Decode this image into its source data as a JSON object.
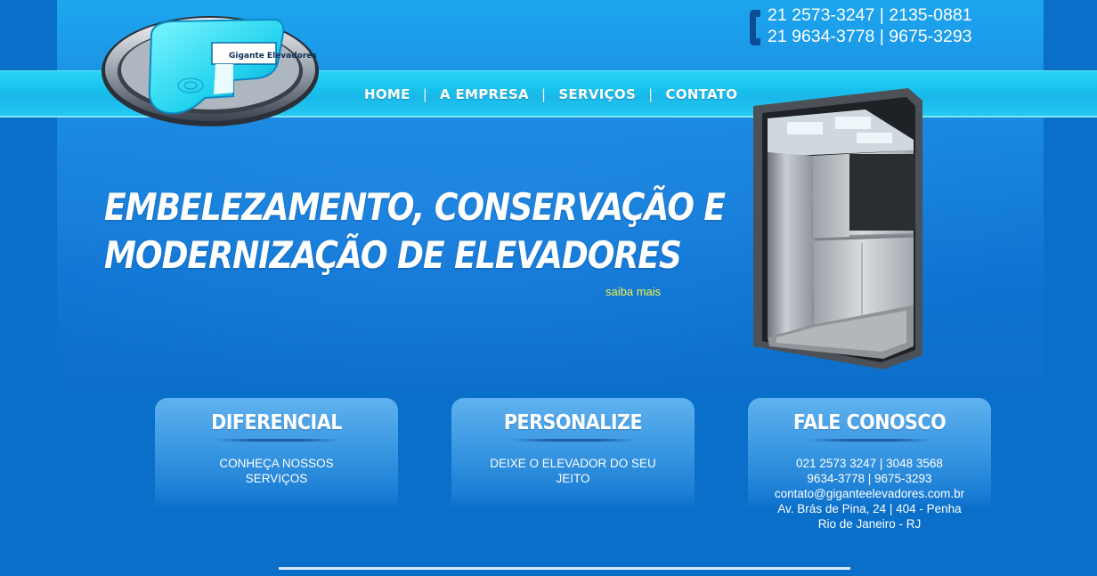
{
  "header": {
    "logo_text": "Gigante Elevadores",
    "phones": [
      "21 2573-3247 | 2135-0881",
      "21 9634-3778 | 9675-3293"
    ]
  },
  "nav": {
    "items": [
      {
        "label": "HOME"
      },
      {
        "label": "A EMPRESA"
      },
      {
        "label": "SERVIÇOS"
      },
      {
        "label": "CONTATO"
      }
    ],
    "separator": "|"
  },
  "hero": {
    "title_line1": "EMBELEZAMENTO, CONSERVAÇÃO E",
    "title_line2": "MODERNIZAÇÃO DE ELEVADORES",
    "link": "saiba mais"
  },
  "cards": [
    {
      "title": "DIFERENCIAL",
      "lines": [
        "CONHEÇA NOSSOS SERVIÇOS"
      ]
    },
    {
      "title": "PERSONALIZE",
      "lines": [
        "DEIXE O ELEVADOR DO SEU JEITO"
      ]
    },
    {
      "title": "FALE CONOSCO",
      "lines": [
        "021 2573 3247 | 3048 3568",
        "9634-3778 | 9675-3293",
        "contato@giganteelevadores.com.br",
        "Av. Brás de Pina, 24 | 404 - Penha",
        "Rio de Janeiro - RJ"
      ]
    }
  ],
  "colors": {
    "background": "#0a6fc9",
    "nav_bar": "#1ab8ea",
    "link_yellow": "#f1f34a",
    "text": "#ffffff"
  }
}
